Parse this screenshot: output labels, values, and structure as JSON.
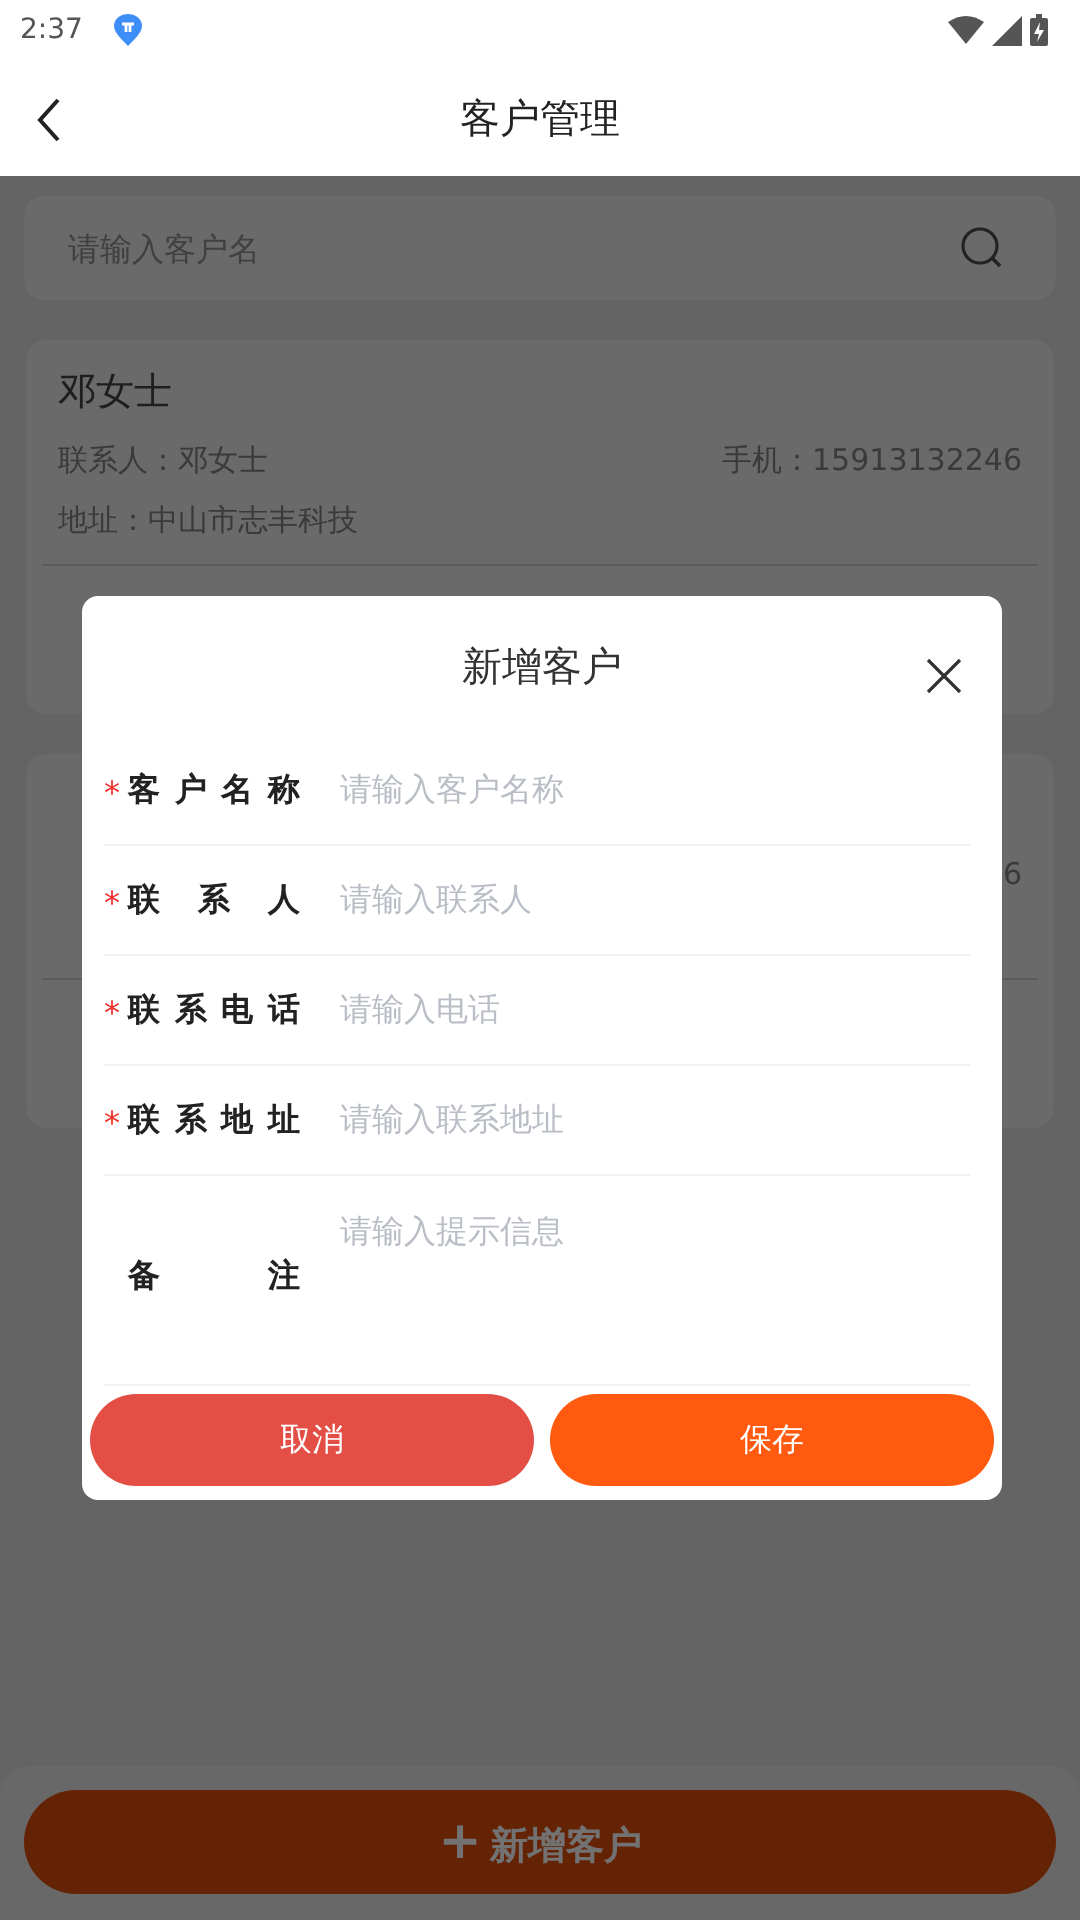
{
  "status_bar": {
    "time": "2:37"
  },
  "header": {
    "title": "客户管理"
  },
  "search": {
    "placeholder": "请输入客户名"
  },
  "customers": [
    {
      "name": "邓女士",
      "contact": "联系人：邓女士",
      "phone": "手机：15913132246",
      "address": "地址：中山市志丰科技"
    },
    {
      "phone": "6"
    }
  ],
  "dialog": {
    "title": "新增客户",
    "fields": [
      {
        "kind": "input",
        "mark": "*",
        "label": "客户名称",
        "placeholder": "请输入客户名称"
      },
      {
        "kind": "input",
        "mark": "*",
        "label": "联系人",
        "placeholder": "请输入联系人"
      },
      {
        "kind": "input",
        "mark": "*",
        "label": "联系电话",
        "placeholder": "请输入电话"
      },
      {
        "kind": "input",
        "mark": "*",
        "label": "联系地址",
        "placeholder": "请输入联系地址"
      },
      {
        "kind": "textarea",
        "label": "备注",
        "placeholder": "请输入提示信息"
      }
    ],
    "buttons": [
      {
        "kind": "cancel",
        "label": "取消"
      },
      {
        "kind": "save",
        "label": "保存"
      }
    ]
  },
  "add_button": {
    "plus": "+",
    "label": "新增客户"
  }
}
